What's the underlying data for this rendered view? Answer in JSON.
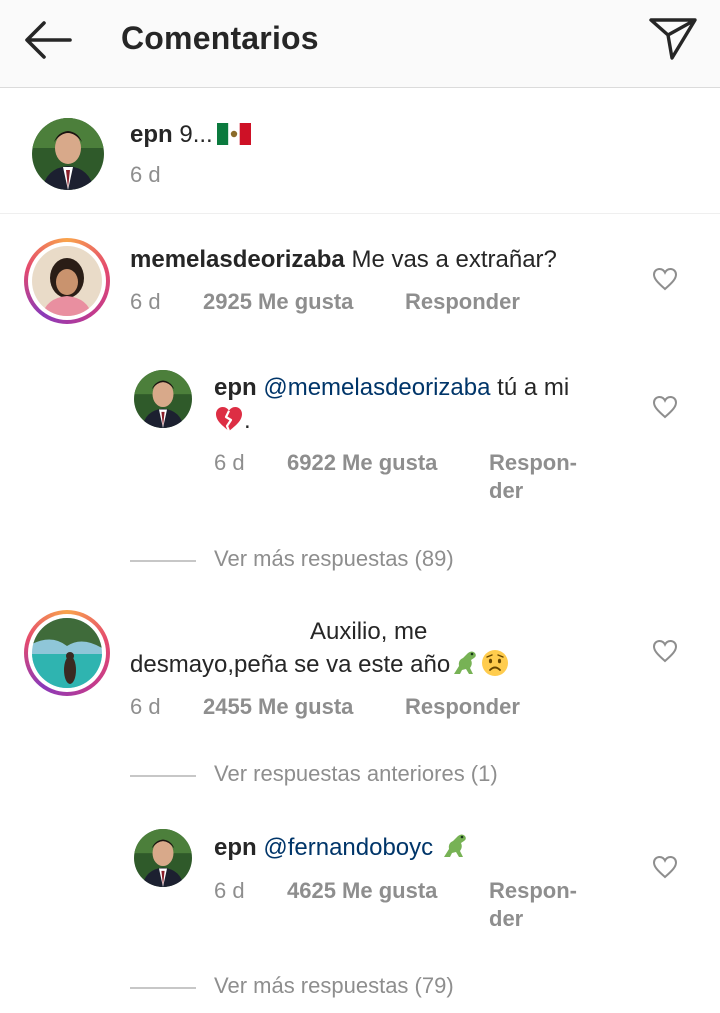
{
  "header": {
    "title": "Comentarios",
    "back_icon": "arrow-left-icon",
    "send_icon": "direct-send-icon"
  },
  "caption": {
    "username": "epn",
    "text": "9...",
    "flag_icon": "mexico-flag-icon",
    "time": "6 d"
  },
  "comments": [
    {
      "username": "memelasdeorizaba",
      "text": "Me vas a extrañar?",
      "time": "6 d",
      "likes": "2925 Me gusta",
      "reply_label": "Responder",
      "reply": {
        "username": "epn",
        "mention": "@memelasdeorizaba",
        "text": "tú a mi",
        "emoji_icon": "broken-heart-icon",
        "after_emoji": ".",
        "time": "6 d",
        "likes": "6922 Me gusta",
        "reply_label_1": "Respon-",
        "reply_label_2": "der"
      },
      "more_replies": "Ver más respuestas (89)"
    },
    {
      "username": "",
      "text_line1": "Auxilio, me",
      "text_line2": "desmayo,peña se va este año",
      "emoji_icons": [
        "dinosaur-icon",
        "worried-face-icon"
      ],
      "time": "6 d",
      "likes": "2455 Me gusta",
      "reply_label": "Responder",
      "previous_replies": "Ver respuestas anteriores (1)",
      "reply": {
        "username": "epn",
        "mention": "@fernandoboyc",
        "emoji_icon": "dinosaur-icon",
        "time": "6 d",
        "likes": "4625 Me gusta",
        "reply_label_1": "Respon-",
        "reply_label_2": "der"
      },
      "more_replies": "Ver más respuestas (79)"
    }
  ],
  "colors": {
    "mention": "#003569",
    "meta": "#8e8e8e",
    "text": "#262626",
    "header_bg": "#fafafa"
  }
}
